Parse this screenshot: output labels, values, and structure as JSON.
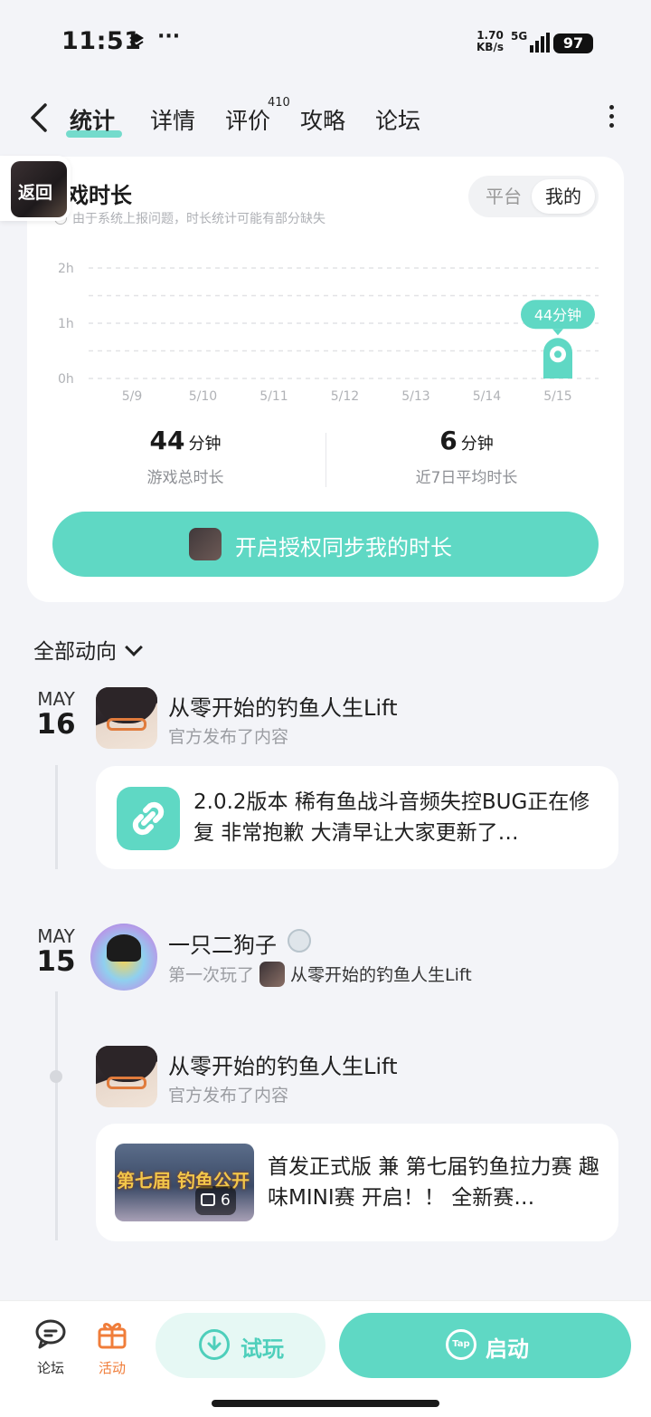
{
  "status_bar": {
    "time": "11:51",
    "more": "···",
    "speed_value": "1.70",
    "speed_unit": "KB/s",
    "network": "5G",
    "battery": "97"
  },
  "nav": {
    "tabs": [
      {
        "label": "统计"
      },
      {
        "label": "详情"
      },
      {
        "label": "评价"
      },
      {
        "label": "攻略"
      },
      {
        "label": "论坛"
      }
    ],
    "review_count": "410",
    "float_back": "返回"
  },
  "stats": {
    "title": "游戏时长",
    "title_visible": "戏时长",
    "note": "由于系统上报问题，时长统计可能有部分缺失",
    "segments": [
      "平台",
      "我的"
    ],
    "total_value": "44",
    "total_unit": "分钟",
    "total_label": "游戏总时长",
    "avg_value": "6",
    "avg_unit": "分钟",
    "avg_label": "近7日平均时长",
    "sync_button": "开启授权同步我的时长"
  },
  "chart_data": {
    "type": "bar",
    "categories": [
      "5/9",
      "5/10",
      "5/11",
      "5/12",
      "5/13",
      "5/14",
      "5/15"
    ],
    "values": [
      0,
      0,
      0,
      0,
      0,
      0,
      44
    ],
    "y_ticks": [
      "0h",
      "1h",
      "2h"
    ],
    "ylim": [
      0,
      120
    ],
    "highlight_label": "44分钟",
    "accent": "#5fd8c4"
  },
  "feed": {
    "filter_label": "全部动向",
    "groups": [
      {
        "month": "MAY",
        "day": "16",
        "author": "从零开始的钓鱼人生Lift",
        "action": "官方发布了内容",
        "post_text": "2.0.2版本 稀有鱼战斗音频失控BUG正在修复 非常抱歉 大清早让大家更新了…"
      },
      {
        "month": "MAY",
        "day": "15",
        "author": "一只二狗子",
        "action": "第一次玩了",
        "game": "从零开始的钓鱼人生Lift"
      },
      {
        "author": "从零开始的钓鱼人生Lift",
        "action": "官方发布了内容",
        "post_text": "首发正式版 兼 第七届钓鱼拉力赛 趣味MINI赛 开启！！ 全新赛…",
        "image_text": "第七届 钓鱼公开",
        "image_count": "6"
      }
    ]
  },
  "bottom_bar": {
    "forum_label": "论坛",
    "activity_label": "活动",
    "trial_label": "试玩",
    "launch_label": "启动",
    "launch_icon_text": "Tap"
  }
}
